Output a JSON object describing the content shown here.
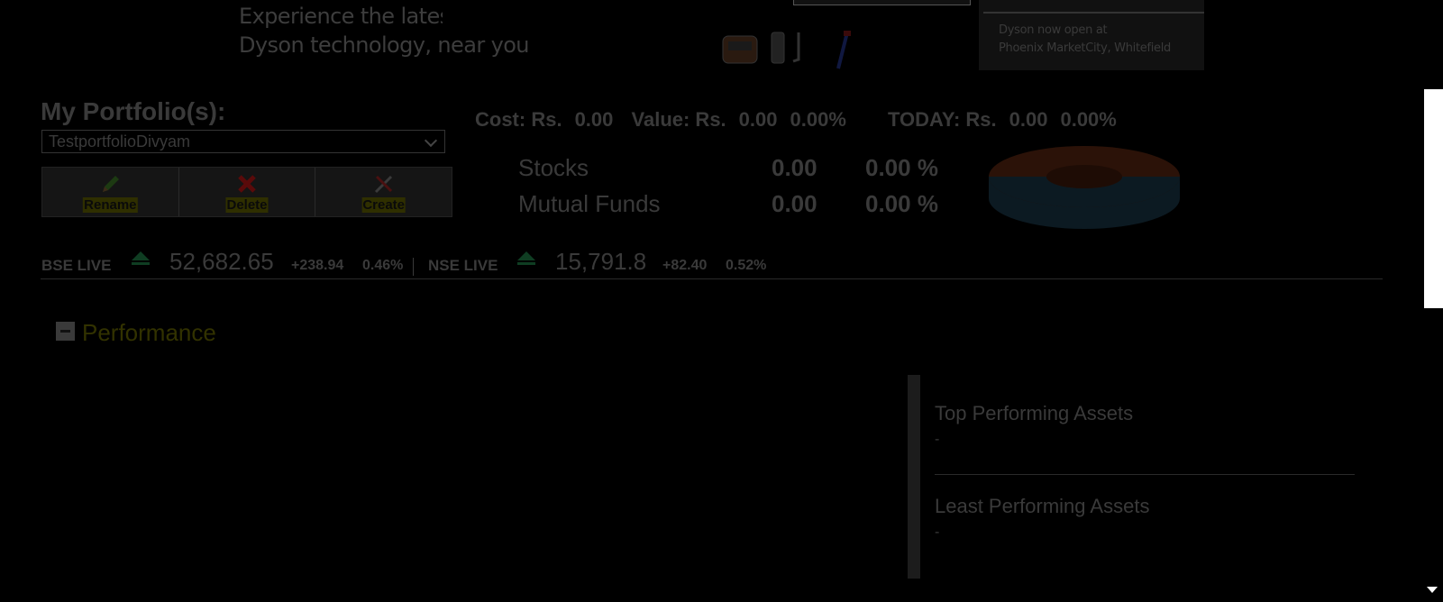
{
  "ad": {
    "headline_line1": "Experience the latest",
    "headline_line2": "Dyson technology, near you",
    "store_line1": "Dyson now open at",
    "store_line2": "Phoenix MarketCity, Whitefield"
  },
  "portfolio": {
    "label": "My Portfolio(s):",
    "selected": "TestportfolioDivyam",
    "actions": [
      {
        "label": "Rename",
        "icon": "pencil-icon"
      },
      {
        "label": "Delete",
        "icon": "red-x-icon"
      },
      {
        "label": "Create",
        "icon": "tools-icon"
      }
    ]
  },
  "summary": {
    "cost_label": "Cost: Rs.",
    "cost_value": "0.00",
    "value_label": "Value: Rs.",
    "value_value": "0.00",
    "value_pct": "0.00%",
    "today_label": "TODAY: Rs.",
    "today_value": "0.00",
    "today_pct": "0.00%"
  },
  "allocation": [
    {
      "name": "Stocks",
      "value": "0.00",
      "pct": "0.00 %"
    },
    {
      "name": "Mutual Funds",
      "value": "0.00",
      "pct": "0.00 %"
    }
  ],
  "colors": {
    "donut_top": "#2b1208",
    "donut_side": "#0c1a22",
    "up_arrow": "#0f3d22",
    "perf_title": "#323200"
  },
  "market": {
    "bse": {
      "label": "BSE LIVE",
      "value": "52,682.65",
      "change": "+238.94",
      "pct": "0.46%"
    },
    "nse": {
      "label": "NSE LIVE",
      "value": "15,791.8",
      "change": "+82.40",
      "pct": "0.52%"
    }
  },
  "performance": {
    "title": "Performance",
    "top_title": "Top Performing Assets",
    "top_value": "-",
    "least_title": "Least Performing Assets",
    "least_value": "-"
  }
}
